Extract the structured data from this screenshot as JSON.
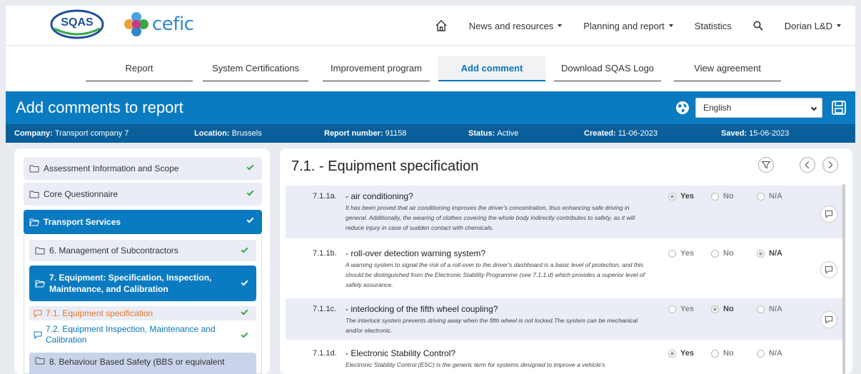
{
  "brand": {
    "sqas": "SQAS",
    "cefic": "cefic"
  },
  "nav": {
    "home": "home-icon",
    "news": "News and resources",
    "planning": "Planning and report",
    "statistics": "Statistics",
    "user": "Dorian L&D"
  },
  "tabs": [
    "Report",
    "System Certifications",
    "Improvement program",
    "Add comment",
    "Download SQAS Logo",
    "View agreement"
  ],
  "header": {
    "title": "Add comments to report",
    "language": "English"
  },
  "info": {
    "company_label": "Company:",
    "company": "Transport company 7",
    "location_label": "Location:",
    "location": "Brussels",
    "report_label": "Report number:",
    "report": "91158",
    "status_label": "Status:",
    "status": "Active",
    "created_label": "Created:",
    "created": "11-06-2023",
    "saved_label": "Saved:",
    "saved": "15-06-2023"
  },
  "sidebar": {
    "items": [
      "Assessment Information and Scope",
      "Core Questionnaire",
      "Transport Services"
    ],
    "sub": [
      "6. Management of Subcontractors",
      "7. Equipment: Specification, Inspection, Maintenance, and Calibration",
      "8. Behaviour Based Safety (BBS or equivalent"
    ],
    "subsub": [
      "7.1. Equipment specification",
      "7.2. Equipment Inspection, Maintenance and Calibration"
    ]
  },
  "main": {
    "title": "7.1. - Equipment specification",
    "options": [
      "Yes",
      "No",
      "N/A"
    ],
    "questions": [
      {
        "num": "7.1.1a.",
        "text": "- air conditioning?",
        "desc": "It has been proved that air conditioning improves the driver's concentration, thus enhancing safe driving in general. Additionally, the wearing of clothes covering the whole body indirectly contributes to safety, as it will reduce injury in case of sudden contact with chemicals."
      },
      {
        "num": "7.1.1b.",
        "text": "- roll-over detection warning system?",
        "desc": "A warning system to signal the risk of a roll-over to the driver's dashboard is a basic level of protection, and this should be distinguished from the Electronic Stability Programme (see 7.1.1.d) which provides a superior level of safety assurance."
      },
      {
        "num": "7.1.1c.",
        "text": "- interlocking of the fifth wheel coupling?",
        "desc": "The interlock system prevents driving away when the fifth wheel is not locked.The system can be mechanical and/or electronic."
      },
      {
        "num": "7.1.1d.",
        "text": "- Electronic Stability Control?",
        "desc": "Electronic Stability Control (ESC) is the generic term for systems designed to improve a vehicle's"
      }
    ]
  }
}
